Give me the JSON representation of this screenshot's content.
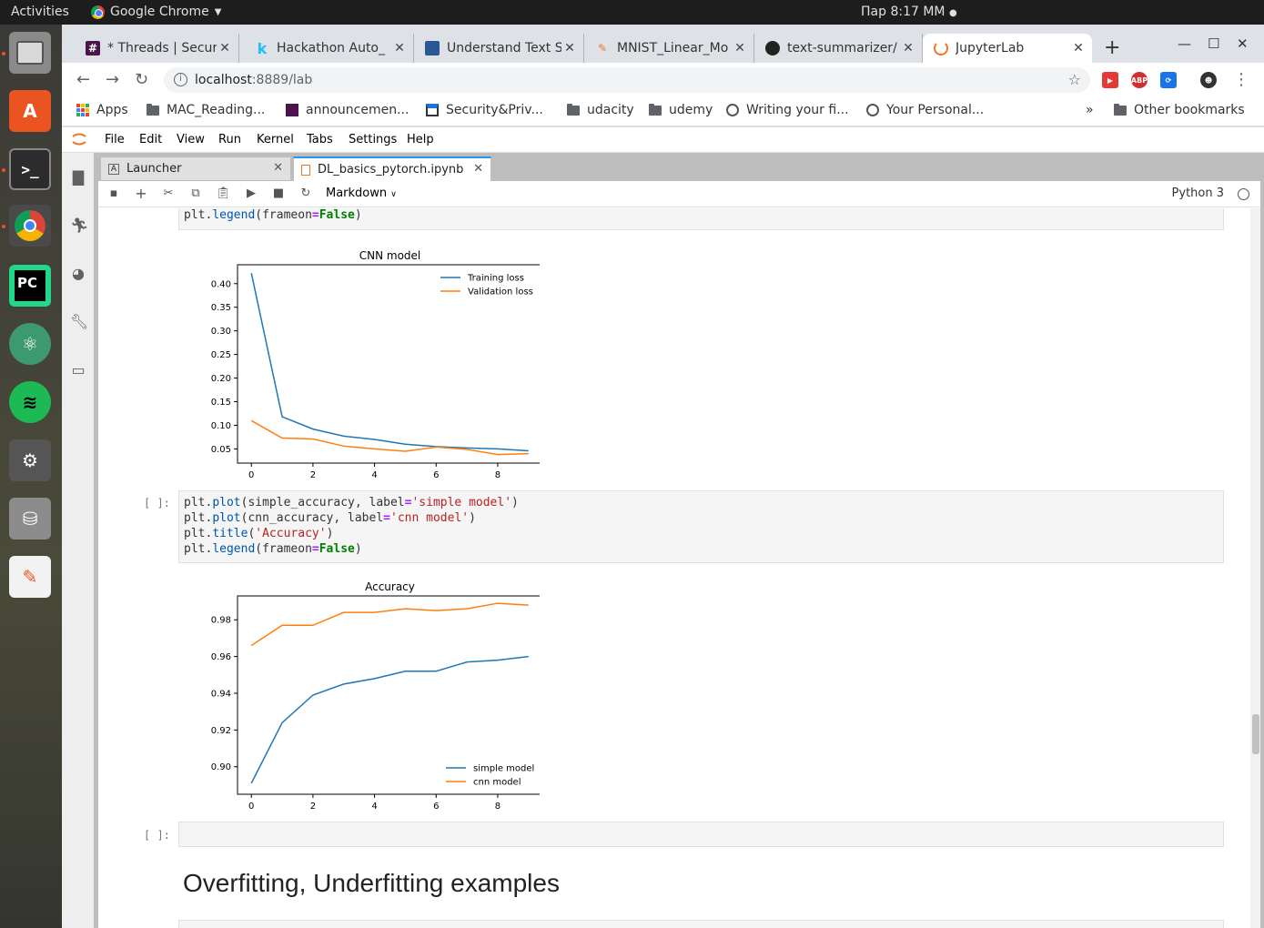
{
  "os": {
    "activities": "Activities",
    "app_name": "Google Chrome",
    "clock": "Пар  8:17 ММ"
  },
  "browser": {
    "tabs": [
      {
        "title": "* Threads | Secure",
        "icon": "slack-icon"
      },
      {
        "title": "Hackathon Auto_",
        "icon": "kaggle-icon"
      },
      {
        "title": "Understand Text S",
        "icon": "doc-icon"
      },
      {
        "title": "MNIST_Linear_Mo",
        "icon": "notebook-icon"
      },
      {
        "title": "text-summarizer/",
        "icon": "github-icon"
      },
      {
        "title": "JupyterLab",
        "icon": "jupyter-icon"
      }
    ],
    "url_host": "localhost",
    "url_rest": ":8889/lab",
    "bookmarks": [
      "Apps",
      "MAC_Reading...",
      "announcemen...",
      "Security&Priv...",
      "udacity",
      "udemy",
      "Writing your fi...",
      "Your Personal..."
    ],
    "bookmarks_more": "»",
    "other_bookmarks": "Other bookmarks"
  },
  "jupyter": {
    "menu": [
      "File",
      "Edit",
      "View",
      "Run",
      "Kernel",
      "Tabs",
      "Settings",
      "Help"
    ],
    "tabs": [
      {
        "label": "Launcher"
      },
      {
        "label": "DL_basics_pytorch.ipynb"
      }
    ],
    "cell_type": "Markdown",
    "kernel": "Python 3",
    "prompt_empty": "[ ]:",
    "heading": "Overfitting, Underfitting examples",
    "cells": {
      "cell1_last_line": "plt.legend(frameon=False)",
      "cell2_lines": [
        "plt.plot(simple_accuracy, label='simple model')",
        "plt.plot(cnn_accuracy, label='cnn model')",
        "plt.title('Accuracy')",
        "plt.legend(frameon=False)"
      ]
    }
  },
  "chart_data": [
    {
      "type": "line",
      "title": "CNN model",
      "x": [
        0,
        1,
        2,
        3,
        4,
        5,
        6,
        7,
        8,
        9
      ],
      "xticks": [
        0,
        2,
        4,
        6,
        8
      ],
      "yticks": [
        0.05,
        0.1,
        0.15,
        0.2,
        0.25,
        0.3,
        0.35,
        0.4
      ],
      "xlim": [
        -0.45,
        9.45
      ],
      "ylim": [
        0.02,
        0.44
      ],
      "legend": "top-right",
      "series": [
        {
          "name": "Training loss",
          "color": "#1f77b4",
          "values": [
            0.422,
            0.118,
            0.092,
            0.077,
            0.07,
            0.06,
            0.055,
            0.052,
            0.05,
            0.046
          ]
        },
        {
          "name": "Validation loss",
          "color": "#ff7f0e",
          "values": [
            0.11,
            0.073,
            0.071,
            0.056,
            0.05,
            0.045,
            0.054,
            0.049,
            0.038,
            0.04
          ]
        }
      ]
    },
    {
      "type": "line",
      "title": "Accuracy",
      "x": [
        0,
        1,
        2,
        3,
        4,
        5,
        6,
        7,
        8,
        9
      ],
      "xticks": [
        0,
        2,
        4,
        6,
        8
      ],
      "yticks": [
        0.9,
        0.92,
        0.94,
        0.96,
        0.98
      ],
      "xlim": [
        -0.45,
        9.45
      ],
      "ylim": [
        0.885,
        0.993
      ],
      "legend": "bottom-right",
      "series": [
        {
          "name": "simple model",
          "color": "#1f77b4",
          "values": [
            0.891,
            0.924,
            0.939,
            0.945,
            0.948,
            0.952,
            0.952,
            0.957,
            0.958,
            0.96
          ]
        },
        {
          "name": "cnn model",
          "color": "#ff7f0e",
          "values": [
            0.966,
            0.977,
            0.977,
            0.984,
            0.984,
            0.986,
            0.985,
            0.986,
            0.989,
            0.988
          ]
        }
      ]
    }
  ]
}
